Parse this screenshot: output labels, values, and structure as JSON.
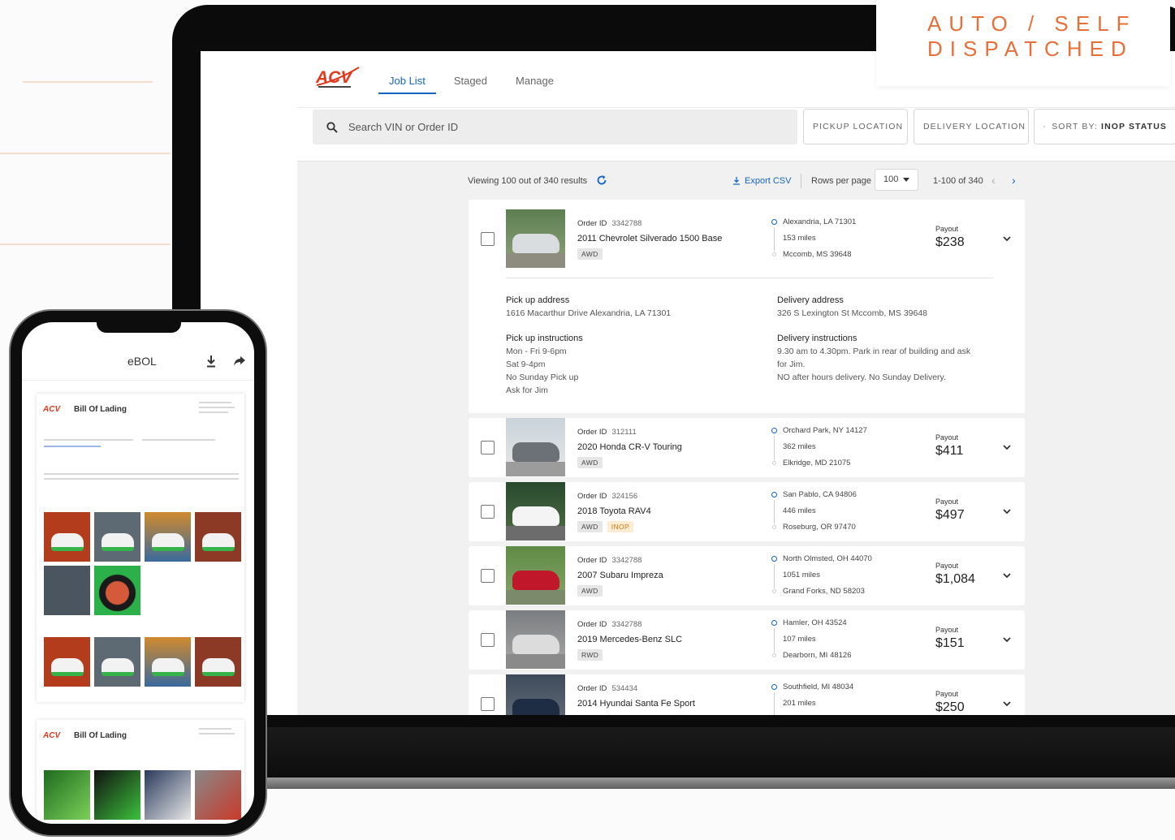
{
  "banner": {
    "line1": "AUTO / SELF",
    "line2": "DISPATCHED"
  },
  "app": {
    "tabs": [
      {
        "label": "Job List",
        "active": true
      },
      {
        "label": "Staged",
        "active": false
      },
      {
        "label": "Manage",
        "active": false
      }
    ],
    "search": {
      "placeholder": "Search VIN or Order ID",
      "icon": "search-icon"
    },
    "filters": {
      "pickup": "PICKUP LOCATION",
      "delivery": "DELIVERY LOCATION",
      "sort_prefix": "SORT BY:",
      "sort_value": "INOP STATUS"
    },
    "results": {
      "viewing": "Viewing 100 out of 340 results",
      "export": "Export CSV",
      "rows_per_page_label": "Rows per page",
      "rows_per_page": "100",
      "range": "1-100 of 340"
    },
    "jobs": [
      {
        "order_label": "Order ID",
        "order_id": "3342788",
        "vehicle": "2011 Chevrolet Silverado 1500 Base",
        "tags": [
          "AWD"
        ],
        "origin": "Alexandria, LA 71301",
        "miles": "153 miles",
        "destination": "Mccomb, MS 39648",
        "payout_label": "Payout",
        "payout": "$238",
        "expanded": true,
        "details": {
          "pickup_address_label": "Pick up address",
          "pickup_address": "1616 Macarthur Drive Alexandria, LA 71301",
          "delivery_address_label": "Delivery address",
          "delivery_address": "326 S Lexington St Mccomb, MS 39648",
          "pickup_instr_label": "Pick up instructions",
          "pickup_instr": [
            "Mon - Fri 9-6pm",
            "Sat 9-4pm",
            "No Sunday Pick up",
            "Ask for Jim"
          ],
          "delivery_instr_label": "Delivery instructions",
          "delivery_instr": [
            "9.30 am to 4.30pm. Park in rear of building and ask",
            "for Jim.",
            "NO after hours delivery. No Sunday Delivery."
          ]
        }
      },
      {
        "order_label": "Order ID",
        "order_id": "312111",
        "vehicle": "2020 Honda CR-V Touring",
        "tags": [
          "AWD"
        ],
        "origin": "Orchard Park, NY 14127",
        "miles": "362 miles",
        "destination": "Elkridge, MD 21075",
        "payout_label": "Payout",
        "payout": "$411"
      },
      {
        "order_label": "Order ID",
        "order_id": "324156",
        "vehicle": "2018 Toyota RAV4",
        "tags": [
          "AWD",
          "INOP"
        ],
        "origin": "San Pablo, CA 94806",
        "miles": "446 miles",
        "destination": "Roseburg, OR 97470",
        "payout_label": "Payout",
        "payout": "$497"
      },
      {
        "order_label": "Order ID",
        "order_id": "3342788",
        "vehicle": "2007 Subaru Impreza",
        "tags": [
          "AWD"
        ],
        "origin": "North Olmsted, OH 44070",
        "miles": "1051 miles",
        "destination": "Grand Forks, ND 58203",
        "payout_label": "Payout",
        "payout": "$1,084"
      },
      {
        "order_label": "Order ID",
        "order_id": "3342788",
        "vehicle": "2019 Mercedes-Benz SLC",
        "tags": [
          "RWD"
        ],
        "origin": "Hamler, OH 43524",
        "miles": "107 miles",
        "destination": "Dearborn, MI 48126",
        "payout_label": "Payout",
        "payout": "$151"
      },
      {
        "order_label": "Order ID",
        "order_id": "534434",
        "vehicle": "2014 Hyundai Santa Fe Sport",
        "tags": [],
        "origin": "Southfield, MI 48034",
        "miles": "201 miles",
        "destination": "",
        "payout_label": "Payout",
        "payout": "$250"
      }
    ]
  },
  "phone": {
    "title": "eBOL",
    "doc1_title": "Bill Of Lading",
    "doc2_title": "Bill Of Lading"
  },
  "colors": {
    "brand_orange": "#e5703a",
    "accent_blue": "#1565c0",
    "logo_red": "#e03a1e"
  }
}
